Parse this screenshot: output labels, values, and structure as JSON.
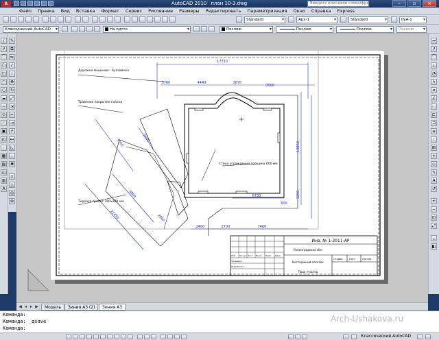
{
  "titlebar": {
    "app_name": "AutoCAD 2010",
    "file_name": "план 10-3.dwg",
    "search_placeholder": "Введите ключевое слово/фразу"
  },
  "menu": [
    "Файл",
    "Правка",
    "Вид",
    "Вставка",
    "Формат",
    "Сервис",
    "Рисование",
    "Размеры",
    "Редактировать",
    "Параметризация",
    "Окно",
    "Справка",
    "Express"
  ],
  "toolbar": {
    "text_style": "Standard",
    "dim_style": "Арх-1",
    "table_style": "Standard",
    "multileader_style": "ifyA-1",
    "workspace": "Классический AutoCAD",
    "layer": "На листе",
    "color": "Послою",
    "linetype": "Послою",
    "lineweight": "Послою",
    "plotstyle": "Послою"
  },
  "tabs": [
    "Модель",
    "Зиния А3 (2)",
    "Зиния А3"
  ],
  "command_lines": [
    "Команда:",
    "Команда: _qsave",
    "Команда:"
  ],
  "status": {
    "coords": "",
    "workspace": "Классический AutoCAD"
  },
  "watermark": "Arch-Ushakova.ru",
  "drawing": {
    "dims": {
      "overall_top": "17710",
      "top_a": "3760",
      "top_b": "4440",
      "top_c": "3870",
      "top_d": "3500",
      "right_a": "13050",
      "right_b": "1200",
      "bottom_a": "6730",
      "bottom_b": "2400",
      "bottom_c": "7460",
      "bottom_d": "2730",
      "bottom_e": "600",
      "left_a": "21450",
      "left_b": "9800",
      "left_c": "5000",
      "diag_a": "3600",
      "diag_b": "2800"
    },
    "labels": {
      "label_1": "Дорожка мощения - бульвинка",
      "label_2": "Травяное покрытие газона",
      "label_3": "Стена ограждения толщина 600 мм",
      "label_4": "Терраса гранит 300х300 мм"
    },
    "stamp": {
      "doc_code": "Инв. № 1-2011-АР",
      "line_1": "Ленинградская обл.",
      "line_2": "Коттеджный поселок",
      "line_3": "План участка",
      "headers": [
        "Изм.",
        "Кол.уч",
        "Лист",
        "№док",
        "Подп.",
        "Дата"
      ],
      "roles": [
        "Проверил",
        "Разработал"
      ],
      "stage_headers": [
        "Стадия",
        "Лист",
        "Листов"
      ]
    }
  }
}
